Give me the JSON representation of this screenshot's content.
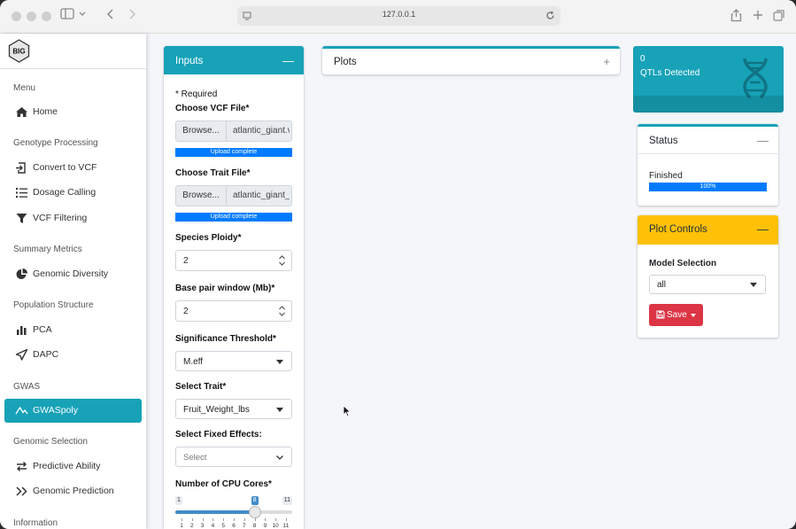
{
  "browser": {
    "url": "127.0.0.1"
  },
  "sidebar": {
    "logo_text": "BIG",
    "sections": {
      "menu": "Menu",
      "genotype": "Genotype Processing",
      "summary": "Summary Metrics",
      "population": "Population Structure",
      "gwas": "GWAS",
      "genomic_selection": "Genomic Selection",
      "information": "Information"
    },
    "items": [
      {
        "label": "Home",
        "icon": "home-icon"
      },
      {
        "label": "Convert to VCF",
        "icon": "file-import-icon"
      },
      {
        "label": "Dosage Calling",
        "icon": "list-icon"
      },
      {
        "label": "VCF Filtering",
        "icon": "filter-icon"
      },
      {
        "label": "Genomic Diversity",
        "icon": "pie-chart-icon"
      },
      {
        "label": "PCA",
        "icon": "bar-chart-icon"
      },
      {
        "label": "DAPC",
        "icon": "send-icon"
      },
      {
        "label": "GWASpoly",
        "icon": "line-chart-icon",
        "active": true
      },
      {
        "label": "Predictive Ability",
        "icon": "arrows-icon"
      },
      {
        "label": "Genomic Prediction",
        "icon": "chevrons-icon"
      }
    ]
  },
  "inputs": {
    "title": "Inputs",
    "collapse": "—",
    "required_note": "* Required",
    "vcf_label": "Choose VCF File*",
    "vcf_browse": "Browse...",
    "vcf_file": "atlantic_giant.vcf",
    "vcf_status": "Upload complete",
    "trait_label": "Choose Trait File*",
    "trait_browse": "Browse...",
    "trait_file": "atlantic_giant_traits.csv",
    "trait_status": "Upload complete",
    "ploidy_label": "Species Ploidy*",
    "ploidy_value": "2",
    "window_label": "Base pair window (Mb)*",
    "window_value": "2",
    "threshold_label": "Significance Threshold*",
    "threshold_value": "M.eff",
    "trait_select_label": "Select Trait*",
    "trait_select_value": "Fruit_Weight_lbs",
    "fixed_label": "Select Fixed Effects:",
    "fixed_placeholder": "Select",
    "cores_label": "Number of CPU Cores*",
    "cores_min": "1",
    "cores_max": "11",
    "cores_value": "8",
    "cores_ticks": [
      "1",
      "2",
      "3",
      "4",
      "5",
      "6",
      "7",
      "8",
      "9",
      "10",
      "11"
    ]
  },
  "plots": {
    "title": "Plots",
    "expand": "+"
  },
  "qtl": {
    "count": "0",
    "label": "QTLs Detected",
    "icon": "dna-icon"
  },
  "status": {
    "title": "Status",
    "collapse": "—",
    "text": "Finished",
    "progress_label": "100%",
    "progress": 1.0
  },
  "plot_controls": {
    "title": "Plot Controls",
    "collapse": "—",
    "model_label": "Model Selection",
    "model_value": "all",
    "save_label": "Save"
  },
  "colors": {
    "accent": "#17a2b8",
    "warning": "#ffc107",
    "danger": "#dc3545",
    "primary": "#007bff"
  }
}
